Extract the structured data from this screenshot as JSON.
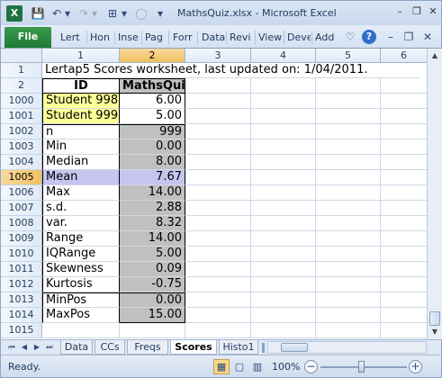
{
  "window": {
    "title": "MathsQuiz.xlsx - Microsoft Excel",
    "logo_letter": "X",
    "controls": {
      "minimize": "–",
      "restore": "❐",
      "close": "✕"
    }
  },
  "quick_access": {
    "save_icon": "💾",
    "undo_icon": "↶",
    "redo_icon": "↷",
    "layout_icon": "⊞",
    "circle_icon": "◯",
    "customize_icon": "▾"
  },
  "ribbon": {
    "file_label": "File",
    "tabs": [
      "Lert",
      "Hon",
      "Inse",
      "Pag",
      "Forr",
      "Data",
      "Revi",
      "View",
      "Deve",
      "Add"
    ],
    "right_icons": {
      "collapse": "♡",
      "help": "?",
      "minimize": "–",
      "restore": "❐",
      "close": "✕"
    }
  },
  "grid": {
    "columns": [
      "1",
      "2",
      "3",
      "4",
      "5",
      "6"
    ],
    "selected_column": "2",
    "title_row": {
      "row": "1",
      "text": "Lertap5 Scores worksheet, last updated on: 1/04/2011."
    },
    "header_row": {
      "row": "2",
      "col1": "ID",
      "col2": "MathsQui"
    },
    "rows": [
      {
        "row": "1000",
        "label": "Student 998",
        "value": "6.00"
      },
      {
        "row": "1001",
        "label": "Student 999",
        "value": "5.00"
      },
      {
        "row": "1002",
        "label": "n",
        "value": "999"
      },
      {
        "row": "1003",
        "label": "Min",
        "value": "0.00"
      },
      {
        "row": "1004",
        "label": "Median",
        "value": "8.00"
      },
      {
        "row": "1005",
        "label": "Mean",
        "value": "7.67"
      },
      {
        "row": "1006",
        "label": "Max",
        "value": "14.00"
      },
      {
        "row": "1007",
        "label": "s.d.",
        "value": "2.88"
      },
      {
        "row": "1008",
        "label": "var.",
        "value": "8.32"
      },
      {
        "row": "1009",
        "label": "Range",
        "value": "14.00"
      },
      {
        "row": "1010",
        "label": "IQRange",
        "value": "5.00"
      },
      {
        "row": "1011",
        "label": "Skewness",
        "value": "0.09"
      },
      {
        "row": "1012",
        "label": "Kurtosis",
        "value": "-0.75"
      },
      {
        "row": "1013",
        "label": "MinPos",
        "value": "0.00"
      },
      {
        "row": "1014",
        "label": "MaxPos",
        "value": "15.00"
      },
      {
        "row": "1015",
        "label": "",
        "value": ""
      }
    ],
    "selected_row": "1005"
  },
  "sheets": {
    "nav": [
      "⏮",
      "◀",
      "▶",
      "⏭"
    ],
    "tabs": [
      "Data",
      "CCs",
      "Freqs",
      "Scores",
      "Histo1"
    ],
    "active": "Scores"
  },
  "status": {
    "text": "Ready.",
    "zoom": "100%",
    "zoom_level_percent": 100,
    "zoom_out": "−",
    "zoom_in": "+"
  }
}
